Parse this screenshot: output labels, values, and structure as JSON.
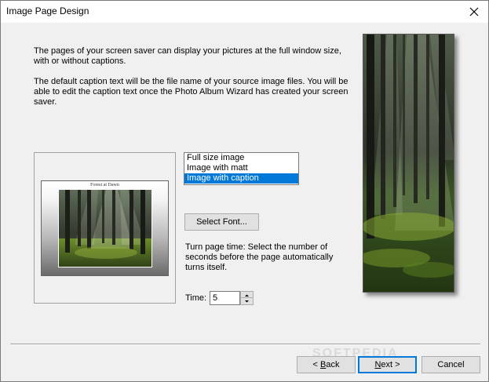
{
  "window": {
    "title": "Image Page Design"
  },
  "intro": {
    "para1": "The pages of your screen saver can display your pictures at the full window size, with or without captions.",
    "para2": "The default caption text will be the file name of your source image files. You will be able to edit the caption text once the Photo Album Wizard has created your screen saver."
  },
  "preview": {
    "caption": "Forest at Dawn"
  },
  "layout_options": {
    "items": [
      {
        "label": "Full size image",
        "selected": false
      },
      {
        "label": "Image with matt",
        "selected": false
      },
      {
        "label": "Image with caption",
        "selected": true
      }
    ]
  },
  "font": {
    "button_label": "Select Font..."
  },
  "timing": {
    "description": "Turn page time: Select the number of seconds before the page automatically turns itself.",
    "label": "Time:",
    "value": "5"
  },
  "footer": {
    "back_prefix": "< ",
    "back_key": "B",
    "back_rest": "ack",
    "next_key": "N",
    "next_rest": "ext >",
    "cancel_label": "Cancel",
    "watermark": "SOFTPEDIA"
  },
  "colors": {
    "selection": "#0078d7",
    "dialog_bg": "#f0f0f0",
    "button_bg": "#e1e1e1"
  }
}
